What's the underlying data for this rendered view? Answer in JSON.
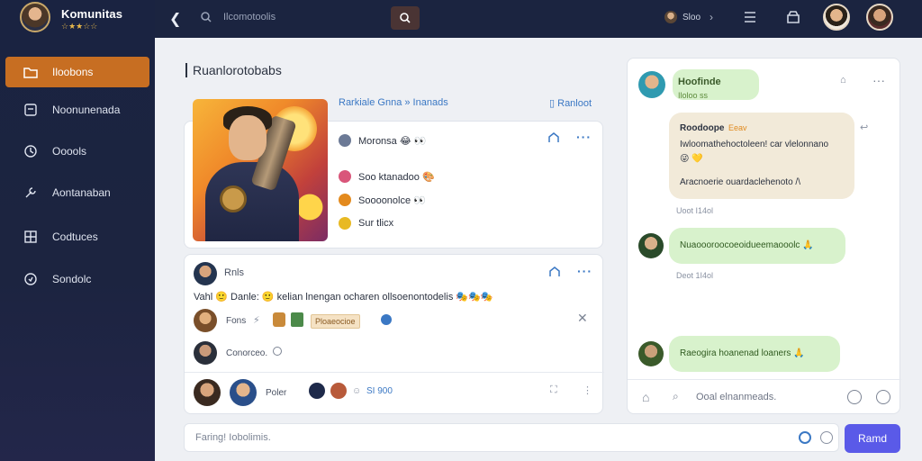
{
  "sidebar": {
    "brand_title": "Komunitas",
    "brand_sub": "☆★★☆☆",
    "items": [
      {
        "label": "Iloobons",
        "icon": "folder-icon",
        "active": true
      },
      {
        "label": "Noonunenada",
        "icon": "chat-square-icon",
        "active": false
      },
      {
        "label": "Ooools",
        "icon": "refresh-icon",
        "active": false
      },
      {
        "label": "Aontanaban",
        "icon": "wrench-icon",
        "active": false
      },
      {
        "label": "Codtuces",
        "icon": "grid-icon",
        "active": false
      },
      {
        "label": "Sondolc",
        "icon": "settings-icon",
        "active": false
      }
    ]
  },
  "topbar": {
    "search_text": "Ilcomotoolis",
    "user_label": "Sloo"
  },
  "main": {
    "page_title": "Ruanlorotobabs",
    "feature_link": "Rarkiale Gnna » Inanads",
    "feature_action": "Ranloot",
    "options": [
      {
        "label": "Moronsa",
        "emoji": "😂 👀",
        "color": "#6c7a96"
      },
      {
        "label": "Soo ktanadoo",
        "emoji": "🎨",
        "color": "#d9567a"
      },
      {
        "label": "Soooonolce",
        "emoji": "👀",
        "color": "#e38a1e"
      },
      {
        "label": "Sur tlicx",
        "emoji": "",
        "color": "#e8b923"
      }
    ],
    "post": {
      "author": "Rnls",
      "text": "Vahl 🙂 Danle: 🙂 kelian lnengan ocharen ollsoenontodelis 🎭🎭🎭",
      "reply1_name": "Fons",
      "reply1_tag": "Ploaeocioe",
      "reply2_name": "Conorceo.",
      "reply3_name": "Poler",
      "reply3_count": "SI 900"
    },
    "composer_placeholder": "Faring! Iobolimis.",
    "send_label": "Ramd"
  },
  "chat": {
    "header_name": "Hoofinde",
    "header_sub": "Iloloo ss",
    "messages": [
      {
        "line1": "Roodoope",
        "line1_tag": "Eeav",
        "line2": "Iwloomathehoctoleen! car vlelonnano",
        "line3": "😜 💛",
        "line4": "Aracnoerie ouardaclehenoto /\\",
        "time": "Uoot  I14ol"
      },
      {
        "text": "Nuaoooroocoeoidueemaooolc 🙏",
        "time": "Deot  1I4ol"
      },
      {
        "text": "Raeogira hoanenad loaners 🙏",
        "time": ""
      }
    ],
    "footer_placeholder": "Ooal elnanmeads."
  }
}
